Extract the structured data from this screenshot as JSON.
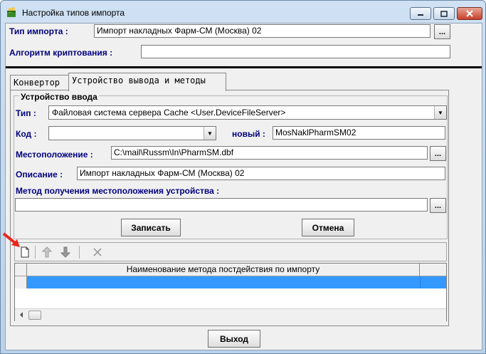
{
  "window": {
    "title": "Настройка типов импорта"
  },
  "form": {
    "import_type_label": "Тип импорта :",
    "import_type_value": "Импорт накладных Фарм-СМ (Москва) 02",
    "crypto_label": "Алгоритм криптования :",
    "crypto_value": "",
    "browse_label": "..."
  },
  "tabs": [
    {
      "label": "Конвертор"
    },
    {
      "label": "Устройство вывода и методы"
    }
  ],
  "input_device": {
    "group_title": "Устройство ввода",
    "type_label": "Тип :",
    "type_value": "Файловая система сервера Cache <User.DeviceFileServer>",
    "code_label": "Код :",
    "code_value": "",
    "new_label": "новый :",
    "new_value": "MosNaklPharmSM02",
    "location_label": "Местоположение :",
    "location_value": "C:\\mail\\Russm\\In\\PharmSM.dbf",
    "description_label": "Описание :",
    "description_value": "Импорт накладных Фарм-СМ (Москва) 02",
    "method_label": "Метод получения местоположения устройства :",
    "method_value": "",
    "save_label": "Записать",
    "cancel_label": "Отмена"
  },
  "grid": {
    "column_header": "Наименование метода постдействия по импорту"
  },
  "footer": {
    "exit_label": "Выход"
  },
  "colors": {
    "selection": "#3399ff",
    "label_color": "#00007f",
    "arrow_red": "#e8261c"
  }
}
